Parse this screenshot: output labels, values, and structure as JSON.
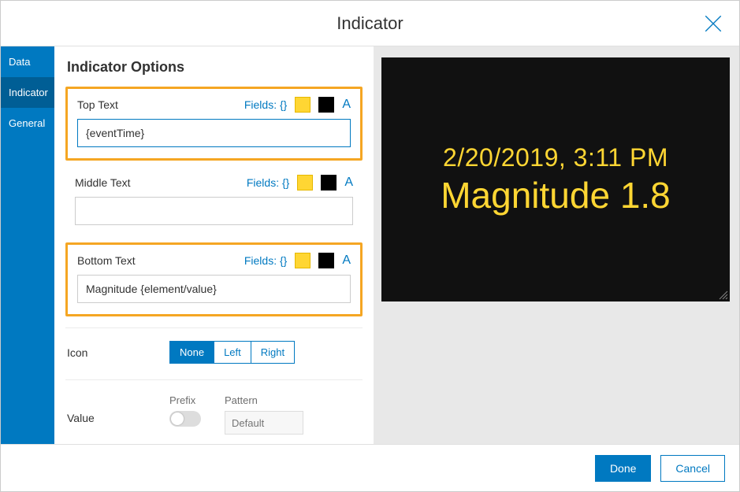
{
  "header": {
    "title": "Indicator"
  },
  "sidebar": {
    "items": [
      {
        "label": "Data",
        "active": false
      },
      {
        "label": "Indicator",
        "active": true
      },
      {
        "label": "General",
        "active": false
      }
    ]
  },
  "options": {
    "title": "Indicator Options",
    "fields_link_label": "Fields: {}",
    "format_indicator_label": "A",
    "top_text": {
      "label": "Top Text",
      "value": "{eventTime}",
      "highlighted": true,
      "focused": true
    },
    "middle_text": {
      "label": "Middle Text",
      "value": "",
      "highlighted": false,
      "focused": false
    },
    "bottom_text": {
      "label": "Bottom Text",
      "value": "Magnitude {element/value}",
      "highlighted": true,
      "focused": false
    },
    "icon": {
      "label": "Icon",
      "options": [
        "None",
        "Left",
        "Right"
      ],
      "selected": "None"
    },
    "value": {
      "label": "Value",
      "prefix": {
        "label": "Prefix",
        "on": false
      },
      "pattern": {
        "label": "Pattern",
        "placeholder": "Default",
        "value": ""
      }
    }
  },
  "preview": {
    "top_text": "2/20/2019, 3:11 PM",
    "middle_text": "Magnitude 1.8",
    "text_color": "#ffd633",
    "background_color": "#111111"
  },
  "footer": {
    "done_label": "Done",
    "cancel_label": "Cancel"
  },
  "icons": {
    "close": "close-icon",
    "resize": "resize-handle-icon"
  }
}
